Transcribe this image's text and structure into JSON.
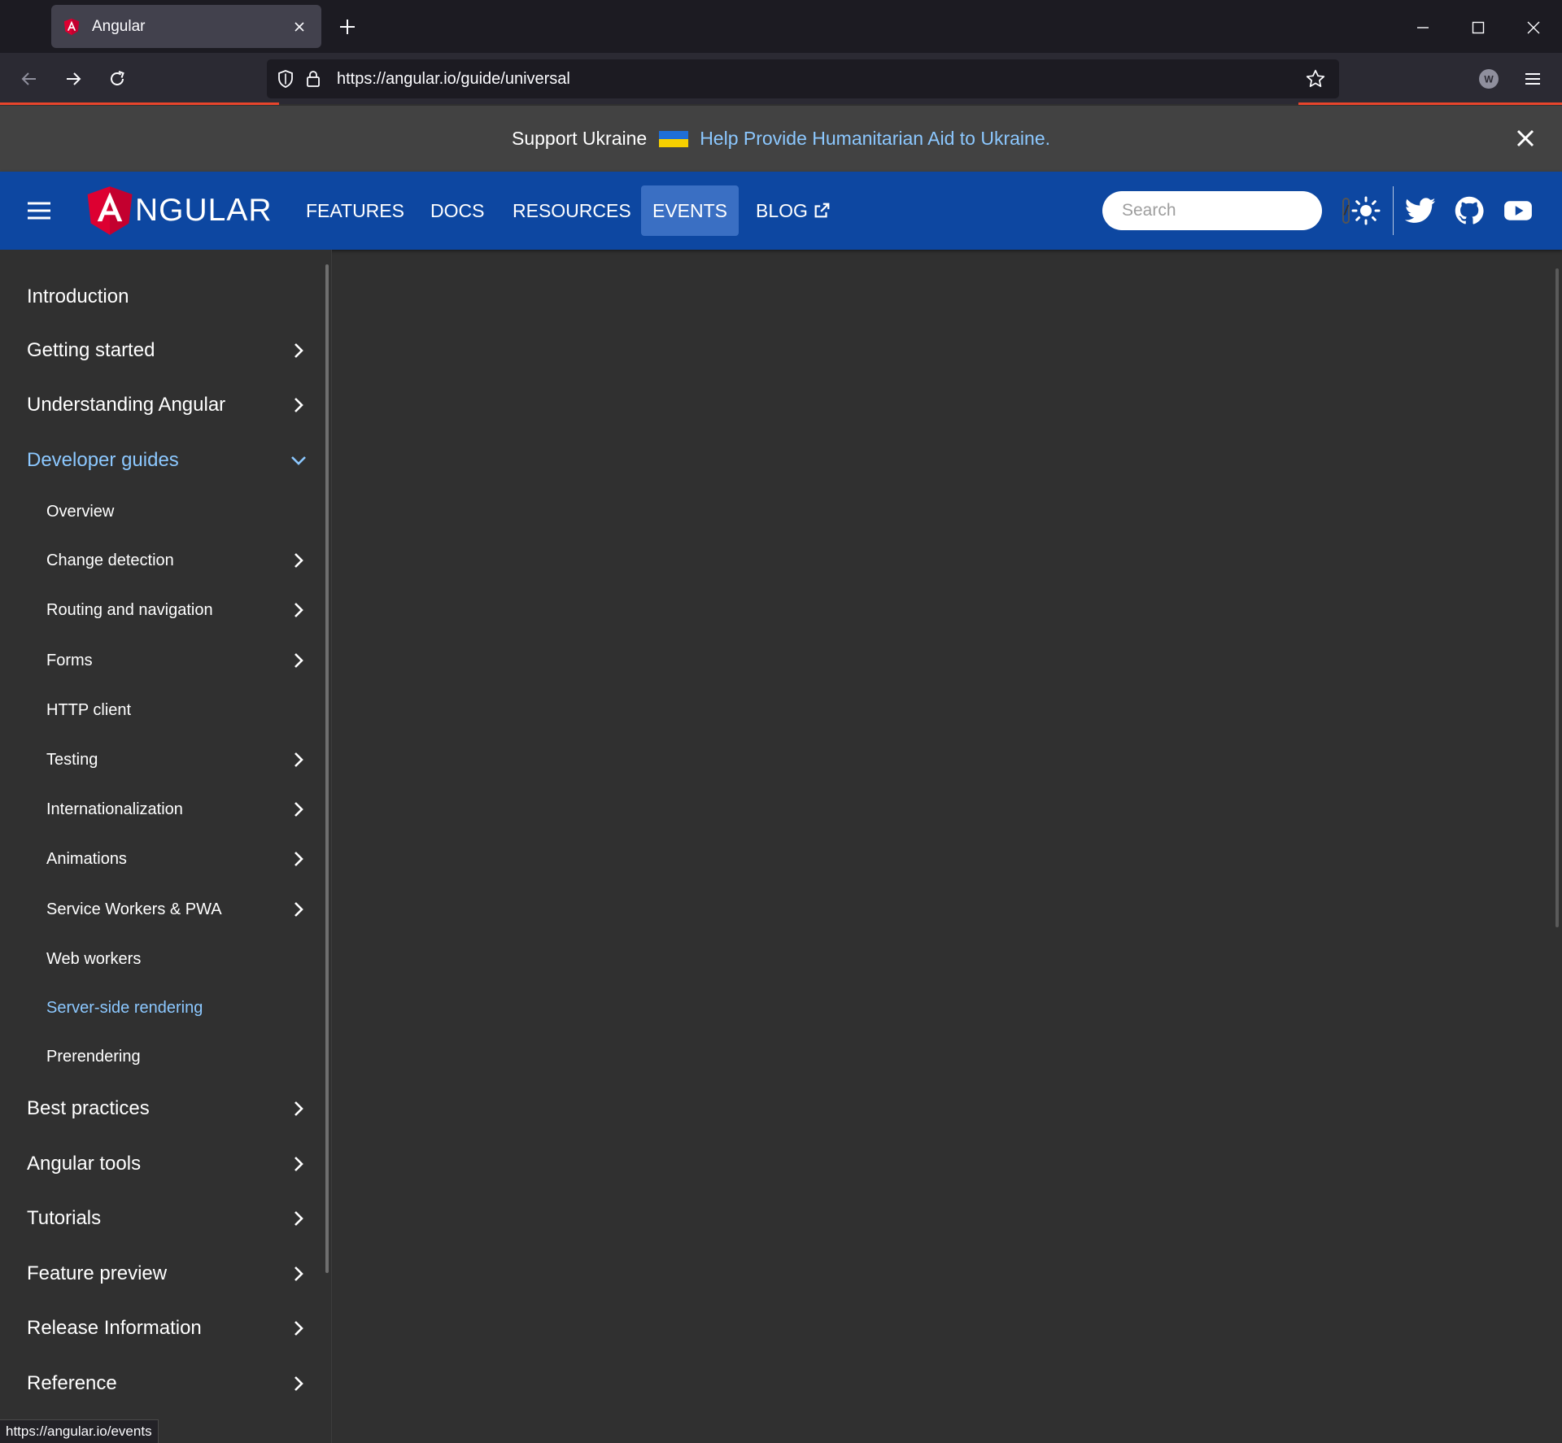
{
  "browser": {
    "tab_title": "Angular",
    "url": "https://angular.io/guide/universal",
    "status_url": "https://angular.io/events",
    "avatar_letter": "W"
  },
  "banner": {
    "text": "Support Ukraine",
    "link": "Help Provide Humanitarian Aid to Ukraine."
  },
  "toolbar": {
    "logo_text": "NGULAR",
    "nav": [
      "FEATURES",
      "DOCS",
      "RESOURCES",
      "EVENTS",
      "BLOG"
    ],
    "search_placeholder": "Search",
    "search_shortcut": "/"
  },
  "sidebar": {
    "items": [
      {
        "label": "Introduction"
      },
      {
        "label": "Getting started"
      },
      {
        "label": "Understanding Angular"
      },
      {
        "label": "Developer guides"
      },
      {
        "label": "Overview"
      },
      {
        "label": "Change detection"
      },
      {
        "label": "Routing and navigation"
      },
      {
        "label": "Forms"
      },
      {
        "label": "HTTP client"
      },
      {
        "label": "Testing"
      },
      {
        "label": "Internationalization"
      },
      {
        "label": "Animations"
      },
      {
        "label": "Service Workers & PWA"
      },
      {
        "label": "Web workers"
      },
      {
        "label": "Server-side rendering"
      },
      {
        "label": "Prerendering"
      },
      {
        "label": "Best practices"
      },
      {
        "label": "Angular tools"
      },
      {
        "label": "Tutorials"
      },
      {
        "label": "Feature preview"
      },
      {
        "label": "Release Information"
      },
      {
        "label": "Reference"
      }
    ]
  },
  "colors": {
    "toolbar": "#0d47a1",
    "active_link": "#8cc8ff",
    "angular_red": "#dd0031",
    "background": "#303030"
  }
}
